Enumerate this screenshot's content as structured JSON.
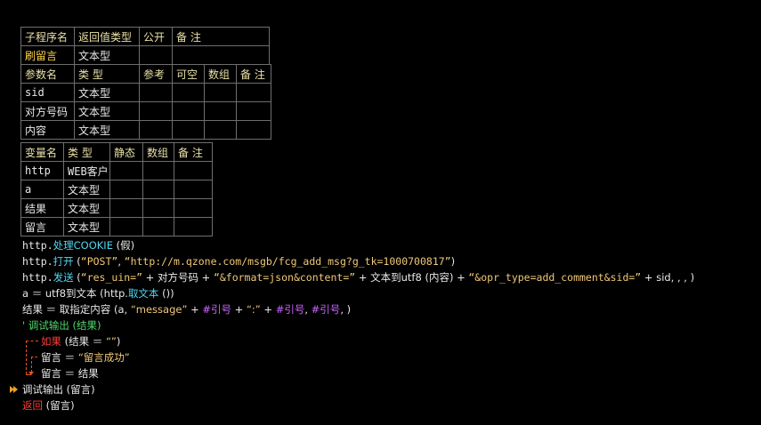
{
  "subroutine_table": {
    "headers": [
      "子程序名",
      "返回值类型",
      "公开",
      "备 注"
    ],
    "row": [
      "刷留言",
      "文本型",
      "",
      ""
    ]
  },
  "params_table": {
    "headers": [
      "参数名",
      "类 型",
      "参考",
      "可空",
      "数组",
      "备 注"
    ],
    "rows": [
      [
        "sid",
        "文本型",
        "",
        "",
        "",
        ""
      ],
      [
        "对方号码",
        "文本型",
        "",
        "",
        "",
        ""
      ],
      [
        "内容",
        "文本型",
        "",
        "",
        "",
        ""
      ]
    ]
  },
  "vars_table": {
    "headers": [
      "变量名",
      "类 型",
      "静态",
      "数组",
      "备 注"
    ],
    "rows": [
      [
        "http",
        "WEB客户",
        "",
        "",
        ""
      ],
      [
        "a",
        "文本型",
        "",
        "",
        ""
      ],
      [
        "结果",
        "文本型",
        "",
        "",
        ""
      ],
      [
        "留言",
        "文本型",
        "",
        "",
        ""
      ]
    ]
  },
  "code": {
    "l1_obj": "http.",
    "l1_cmd": "处理COOKIE",
    "l1_arg": " (假)",
    "l2_obj": "http.",
    "l2_cmd": "打开",
    "l2_open": " (",
    "l2_s1": "“POST”",
    "l2_sep": ", ",
    "l2_s2": "“http://m.qzone.com/msgb/fcg_add_msg?g_tk=1000700817”",
    "l2_close": ")",
    "l3_obj": "http.",
    "l3_cmd": "发送",
    "l3_open": " (",
    "l3_s1": "“res_uin=”",
    "l3_a": " + 对方号码 + ",
    "l3_s2": "“&format=json&content=”",
    "l3_b": " + 文本到utf8 (内容) + ",
    "l3_s3": "“&opr_type=add_comment&sid=”",
    "l3_c": " + sid, , , )",
    "l4_pre": "a ＝ utf8到文本 (http.",
    "l4_cmd": "取文本",
    "l4_post": " ())",
    "l5_pre": "结果 ＝ 取指定内容 (a, ",
    "l5_s1": "“message”",
    "l5_a": " + ",
    "l5_sym1": "#引号",
    "l5_b": " + ",
    "l5_s2": "“:”",
    "l5_c": " + ",
    "l5_sym2": "#引号",
    "l5_d": ", ",
    "l5_sym3": "#引号",
    "l5_e": ", )",
    "l6": "' 调试输出 (结果)",
    "l7_kw": "如果",
    "l7_a": " (结果 ＝ ",
    "l7_s": "“”",
    "l7_b": ")",
    "l8_pre": "留言 ＝ ",
    "l8_s": "“留言成功”",
    "l9": "留言 ＝ 结果",
    "l10": "调试输出 (留言)",
    "l11_kw": "返回",
    "l11_arg": " (留言)"
  }
}
